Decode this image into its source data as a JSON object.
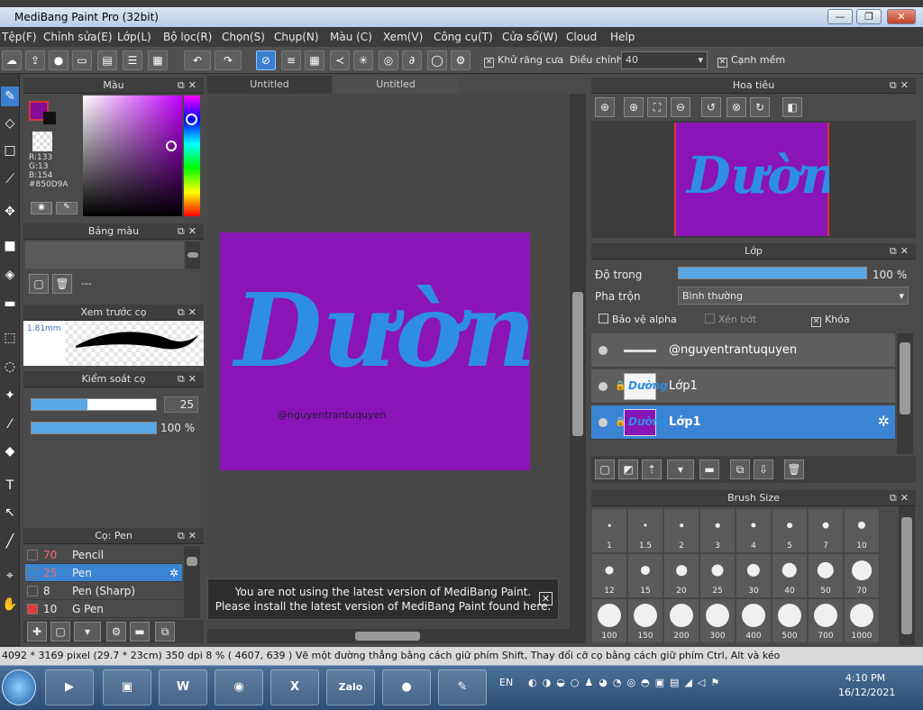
{
  "window": {
    "title": "MediBang Paint Pro (32bit)",
    "min": "—",
    "max": "❐",
    "close": "✕"
  },
  "menu": [
    "Tệp(F)",
    "Chỉnh sửa(E)",
    "Lớp(L)",
    "Bộ lọc(R)",
    "Chọn(S)",
    "Chụp(N)",
    "Màu (C)",
    "Xem(V)",
    "Công cụ(T)",
    "Cửa sổ(W)",
    "Cloud",
    "Help"
  ],
  "toolbar": {
    "antialias_label": "Khử răng cưa",
    "adjust_label": "Điều chỉnh",
    "adjust_value": "40",
    "smooth_label": "Cạnh mềm",
    "check_mark": "✕"
  },
  "color_panel": {
    "title": "Màu",
    "r": "R:133",
    "g": "G:13",
    "b": "B:154",
    "hex": "#850D9A",
    "primary": "#850D9A"
  },
  "palette_panel": {
    "title": "Bảng màu",
    "empty": "---"
  },
  "brush_preview_panel": {
    "title": "Xem trước cọ",
    "size": "1.81mm"
  },
  "brush_control_panel": {
    "title": "Kiểm soát cọ",
    "size_value": "25",
    "opacity_value": "100 %",
    "size_fill": 0.45,
    "opacity_fill": 1.0
  },
  "brush_list_panel": {
    "title": "Cọ: Pen",
    "items": [
      {
        "size": "70",
        "name": "Pencil",
        "swatch": "#3a3a3a"
      },
      {
        "size": "25",
        "name": "Pen",
        "swatch": "#3a3a3a"
      },
      {
        "size": "8",
        "name": "Pen (Sharp)",
        "swatch": "#3a3a3a"
      },
      {
        "size": "10",
        "name": "G Pen",
        "swatch": "#e23b3b"
      }
    ]
  },
  "tabs": [
    "Untitled",
    "Untitled"
  ],
  "artwork": {
    "word": "Dường",
    "signature": "@nguyentrantuquyen",
    "background": "#8A14B8",
    "ink": "#2E8EE6"
  },
  "navigator_panel": {
    "title": "Hoa tiêu"
  },
  "layer_panel": {
    "title": "Lớp",
    "opacity_label": "Độ trong",
    "opacity_value": "100 %",
    "blend_label": "Pha trộn",
    "blend_value": "Bình thường",
    "protect_alpha": "Bảo vệ alpha",
    "clipping": "Xén bớt",
    "lock": "Khóa",
    "layers": [
      {
        "name": "@nguyentrantuquyen",
        "selected": false
      },
      {
        "name": "Lớp1",
        "selected": false
      },
      {
        "name": "Lớp1",
        "selected": true
      }
    ]
  },
  "brush_size_panel": {
    "title": "Brush Size",
    "sizes": [
      "1",
      "1.5",
      "2",
      "3",
      "4",
      "5",
      "7",
      "10",
      "12",
      "15",
      "20",
      "25",
      "30",
      "40",
      "50",
      "70",
      "100",
      "150",
      "200",
      "300",
      "400",
      "500",
      "700",
      "1000"
    ]
  },
  "toast": {
    "line1": "You are not using the latest version of MediBang Paint.",
    "line2": "Please install the latest version of MediBang Paint found here.",
    "close": "✕"
  },
  "status": "4092 * 3169 pixel  (29.7 * 23cm)  350 dpi  8 %  ( 4607, 639 )  Vẽ một đường thẳng bằng cách giữ phím Shift, Thay đổi cỡ cọ bằng cách giữ phím Ctrl, Alt và kéo",
  "taskbar": {
    "lang": "EN",
    "time": "4:10 PM",
    "date": "16/12/2021",
    "apps": [
      "W",
      "X",
      "Zalo"
    ]
  }
}
